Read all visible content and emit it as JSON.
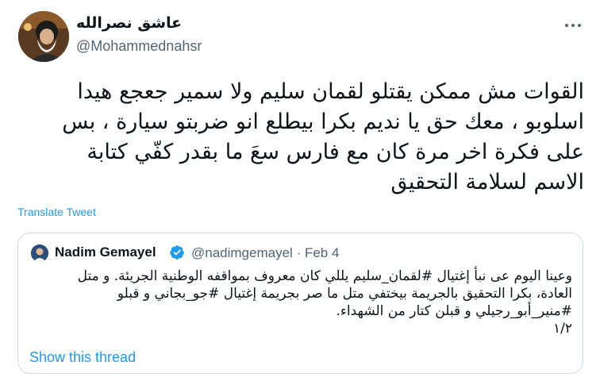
{
  "author": {
    "display_name": "عاشق نصرالله",
    "handle": "@Mohammednahsr"
  },
  "tweet": {
    "lines": [
      "القوات مش ممكن يقتلو لقمان سليم ولا سمير جعجع هيدا",
      "اسلوبو ، معك حق يا نديم بكرا بيطلع انو ضربتو سيارة ، بس",
      "على فكرة اخر مرة كان مع فارس سعَ ما بقدر كفّي كتابة",
      "الاسم لسلامة التحقيق"
    ]
  },
  "translate_label": "Translate Tweet",
  "quote": {
    "name": "Nadim Gemayel",
    "handle": "@nadimgemayel",
    "separator": "·",
    "date": "Feb 4",
    "lines": [
      "وعينا اليوم عى نبأ إغتيال #لقمان_سليم يللي كان معروف بمواقفه الوطنية الجريئة. و متل",
      "العادة، بكرا التحقيق بالجريمة بيختفي متل ما صر بجريمة إغتيال #جو_بجاني و قبلو",
      "#منير_أبو_رجيلي و قبلن كتار من الشهداء.",
      "١/٢"
    ],
    "show_thread_label": "Show this thread",
    "verified": true
  },
  "colors": {
    "link": "#1d9bf0",
    "muted": "#536471",
    "border": "#cfd9de",
    "text": "#0f1419"
  },
  "icons": {
    "more": "more-icon",
    "verified": "verified-badge-icon"
  }
}
